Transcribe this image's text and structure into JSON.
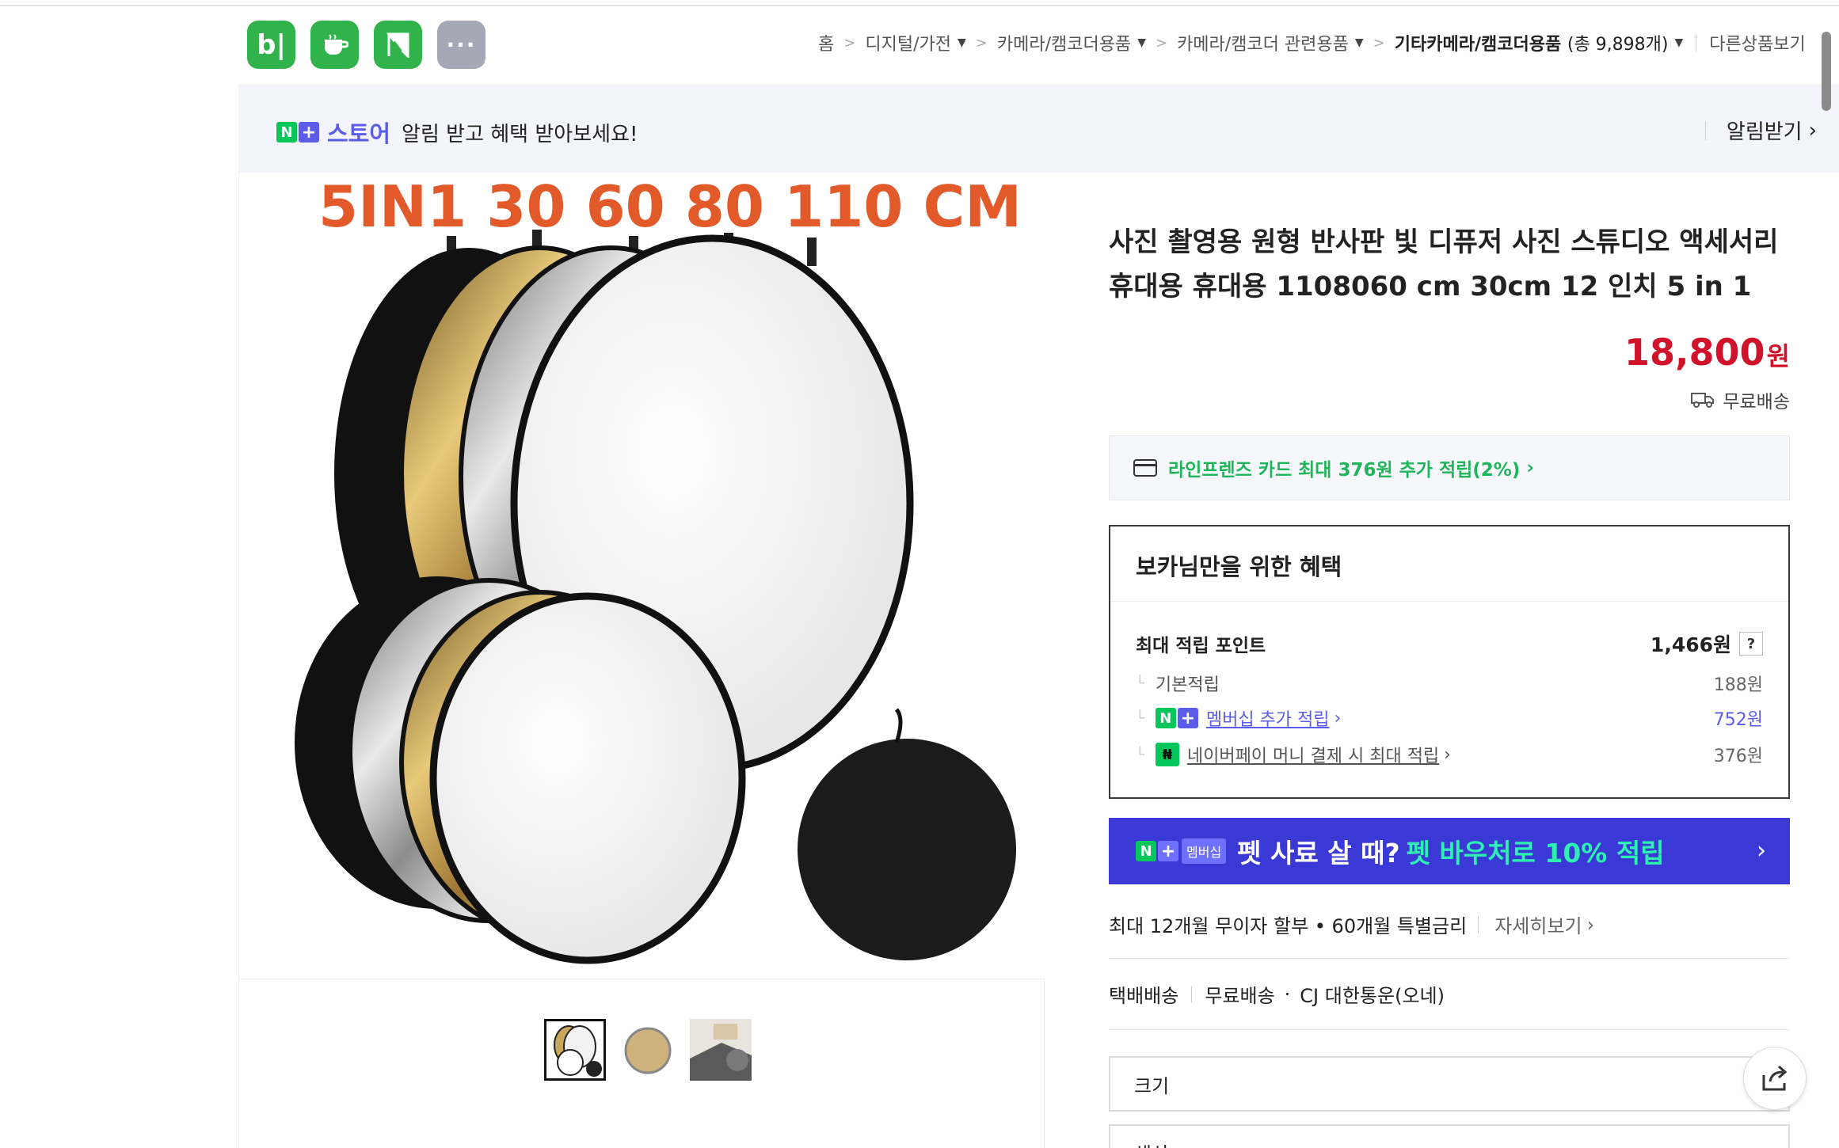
{
  "header": {
    "app_icons": [
      {
        "name": "blog",
        "glyph": "b|"
      },
      {
        "name": "cafe",
        "glyph": "☕"
      },
      {
        "name": "bookmark",
        "glyph": "◣"
      },
      {
        "name": "more",
        "glyph": "···"
      }
    ],
    "breadcrumb": {
      "home": "홈",
      "items": [
        "디지털/가전",
        "카메라/캠코더용품",
        "카메라/캠코더 관련용품"
      ],
      "current": "기타카메라/캠코더용품",
      "current_count": "(총 9,898개)",
      "other": "다른상품보기"
    }
  },
  "notice": {
    "badge_n": "N",
    "badge_plus": "+",
    "store": "스토어",
    "message": "알림 받고 혜택 받아보세요!",
    "action": "알림받기"
  },
  "image_panel": {
    "headline": "5IN1 30 60 80 110 CM",
    "thumbnails": [
      "thumb-1",
      "thumb-2",
      "thumb-3"
    ],
    "selected_thumbnail": 0
  },
  "product": {
    "title": "사진 촬영용 원형 반사판 빛 디퓨저 사진 스튜디오 액세서리 휴대용 휴대용 1108060 cm 30cm 12 인치 5 in 1",
    "price": "18,800",
    "price_unit": "원",
    "shipping_badge": "무료배송",
    "card_promo": "라인프렌즈 카드 최대 376원 추가 적립(2%)"
  },
  "benefit": {
    "title": "보카님만을 위한 혜택",
    "max_label": "최대 적립 포인트",
    "max_value": "1,466원",
    "help": "?",
    "rows": [
      {
        "label": "기본적립",
        "value": "188원"
      },
      {
        "label": "멤버십 추가 적립",
        "value": "752원"
      },
      {
        "label": "네이버페이 머니 결제 시 최대 적립",
        "value": "376원"
      }
    ]
  },
  "promo": {
    "badge_n": "N",
    "badge_plus": "+",
    "membership": "멤버십",
    "question": "펫 사료 살 때?",
    "highlight": "펫 바우처로 10% 적립"
  },
  "installment": {
    "text": "최대 12개월 무이자 할부 • 60개월 특별금리",
    "more": "자세히보기"
  },
  "delivery": {
    "method": "택배배송",
    "fee": "무료배송",
    "carrier": "CJ 대한통운(오네)"
  },
  "options": {
    "size_label": "크기",
    "second_label": "색상"
  },
  "colors": {
    "naver_green": "#03c75a",
    "naver_purple": "#5b5de8",
    "price_red": "#d0132a",
    "promo_bg": "#3a39d6",
    "promo_highlight": "#2ef0b2"
  }
}
